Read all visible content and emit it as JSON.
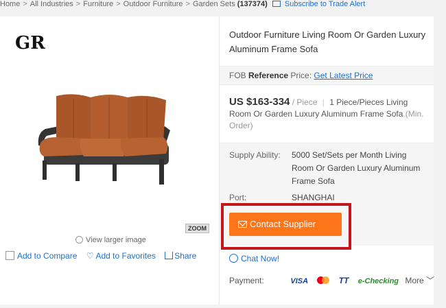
{
  "breadcrumb": {
    "items": [
      "Home",
      "All Industries",
      "Furniture",
      "Outdoor Furniture",
      "Garden Sets"
    ],
    "count": "(137374)",
    "alert": "Subscribe to Trade Alert"
  },
  "gallery": {
    "brand_text": "GR",
    "zoom_label": "ZOOM",
    "view_larger": "View larger image"
  },
  "actions": {
    "compare": "Add to Compare",
    "favorites": "Add to Favorites",
    "share": "Share"
  },
  "product": {
    "title": "Outdoor Furniture Living Room Or Garden Luxury Aluminum Frame Sofa",
    "fob_prefix": "FOB",
    "fob_reference": "Reference",
    "fob_price": "Price:",
    "fob_link": "Get Latest Price",
    "price": "US $163-334",
    "unit": "/ Piece",
    "min_order": "1 Piece/Pieces Living Room Or Garden Luxury Aluminum Frame Sofa",
    "min_order_suffix": "(Min. Order)",
    "supply_label": "Supply Ability:",
    "supply_value": "5000 Set/Sets per Month Living Room Or Garden Luxury Aluminum Frame Sofa",
    "port_label": "Port:",
    "port_value": "SHANGHAI",
    "contact_button": "Contact Supplier",
    "chat": "Chat Now!",
    "payment_label": "Payment:",
    "payment_methods": {
      "visa": "VISA",
      "tt": "TT",
      "echecking": "e-Checking"
    },
    "more": "More"
  },
  "colors": {
    "link": "#1e6fc9",
    "accent": "#ff7519",
    "highlight": "#c4161c"
  }
}
